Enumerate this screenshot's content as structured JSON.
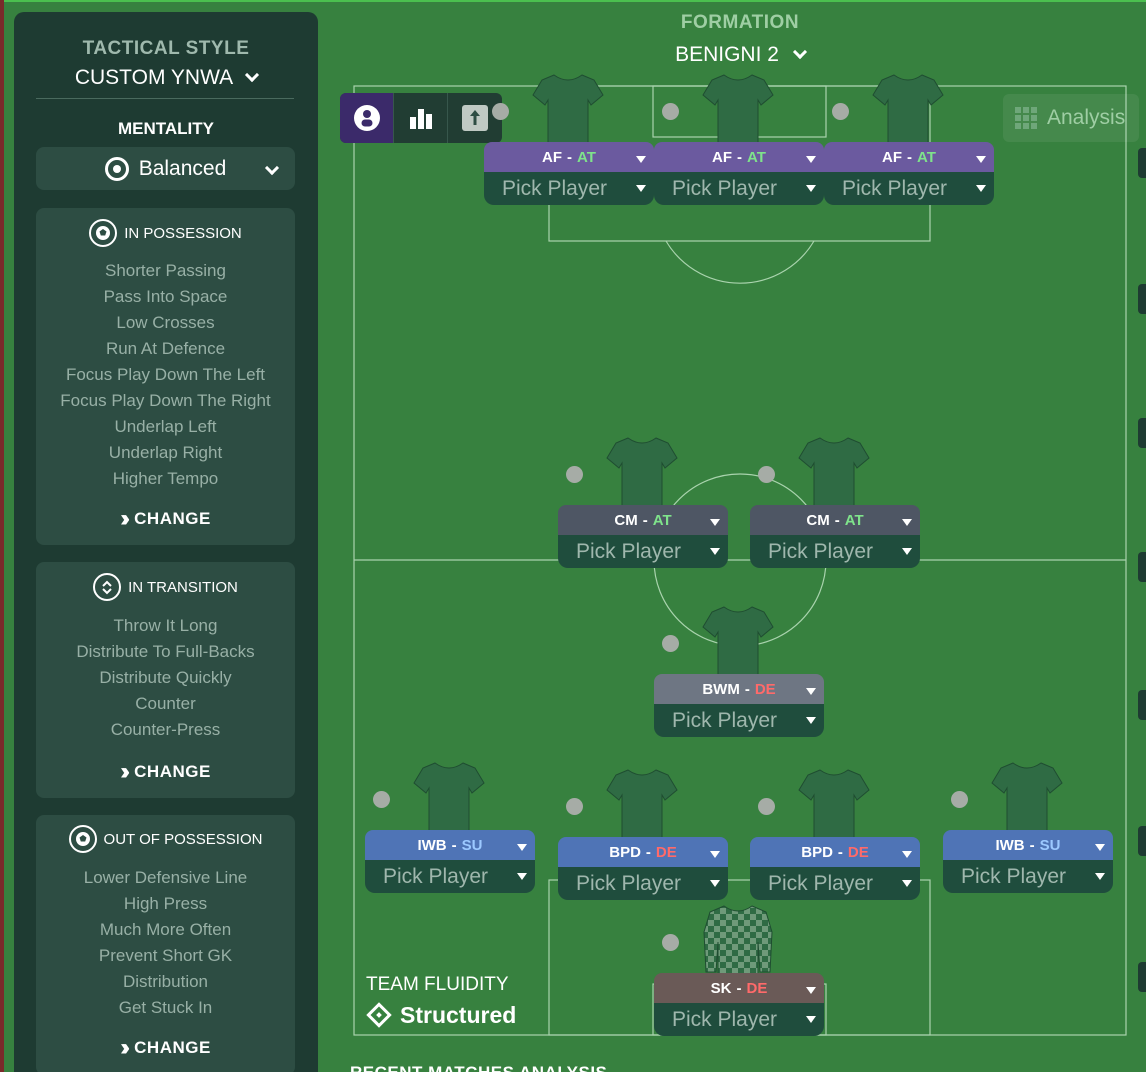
{
  "sidebar": {
    "tactical_style_label": "TACTICAL STYLE",
    "tactical_style_value": "CUSTOM YNWA",
    "mentality_label": "MENTALITY",
    "mentality_value": "Balanced",
    "in_possession": {
      "title": "IN POSSESSION",
      "items": [
        "Shorter Passing",
        "Pass Into Space",
        "Low Crosses",
        "Run At Defence",
        "Focus Play Down The Left",
        "Focus Play Down The Right",
        "Underlap Left",
        "Underlap Right",
        "Higher Tempo"
      ],
      "change_label": "CHANGE"
    },
    "in_transition": {
      "title": "IN TRANSITION",
      "items": [
        "Throw It Long",
        "Distribute To Full-Backs",
        "Distribute Quickly",
        "Counter",
        "Counter-Press"
      ],
      "change_label": "CHANGE"
    },
    "out_of_possession": {
      "title": "OUT OF POSSESSION",
      "items": [
        "Lower Defensive Line",
        "High Press",
        "Much More Often",
        "Prevent Short GK",
        "Distribution",
        "Get Stuck In"
      ],
      "change_label": "CHANGE"
    }
  },
  "formation": {
    "label": "FORMATION",
    "value": "BENIGNI 2"
  },
  "toolbar": {
    "analysis_label": "Analysis"
  },
  "players": [
    {
      "role": "AF",
      "duty": "AT",
      "pick": "Pick Player"
    },
    {
      "role": "AF",
      "duty": "AT",
      "pick": "Pick Player"
    },
    {
      "role": "AF",
      "duty": "AT",
      "pick": "Pick Player"
    },
    {
      "role": "CM",
      "duty": "AT",
      "pick": "Pick Player"
    },
    {
      "role": "CM",
      "duty": "AT",
      "pick": "Pick Player"
    },
    {
      "role": "BWM",
      "duty": "DE",
      "pick": "Pick Player"
    },
    {
      "role": "IWB",
      "duty": "SU",
      "pick": "Pick Player"
    },
    {
      "role": "BPD",
      "duty": "DE",
      "pick": "Pick Player"
    },
    {
      "role": "BPD",
      "duty": "DE",
      "pick": "Pick Player"
    },
    {
      "role": "IWB",
      "duty": "SU",
      "pick": "Pick Player"
    },
    {
      "role": "SK",
      "duty": "DE",
      "pick": "Pick Player"
    }
  ],
  "team_fluidity": {
    "label": "TEAM FLUIDITY",
    "value": "Structured"
  },
  "footer": {
    "section_title": "RECENT MATCHES ANALYSIS"
  },
  "colors": {
    "pitch": "#37813f",
    "sidebar": "#1e3b32",
    "panel": "#2d4d43",
    "attack_duty": "#7fe38b",
    "defend_duty": "#ff6a6a",
    "support_duty": "#9cc9ff",
    "forward_role_bar": "#6b5a9f",
    "fullback_role_bar": "#4f74b6"
  }
}
